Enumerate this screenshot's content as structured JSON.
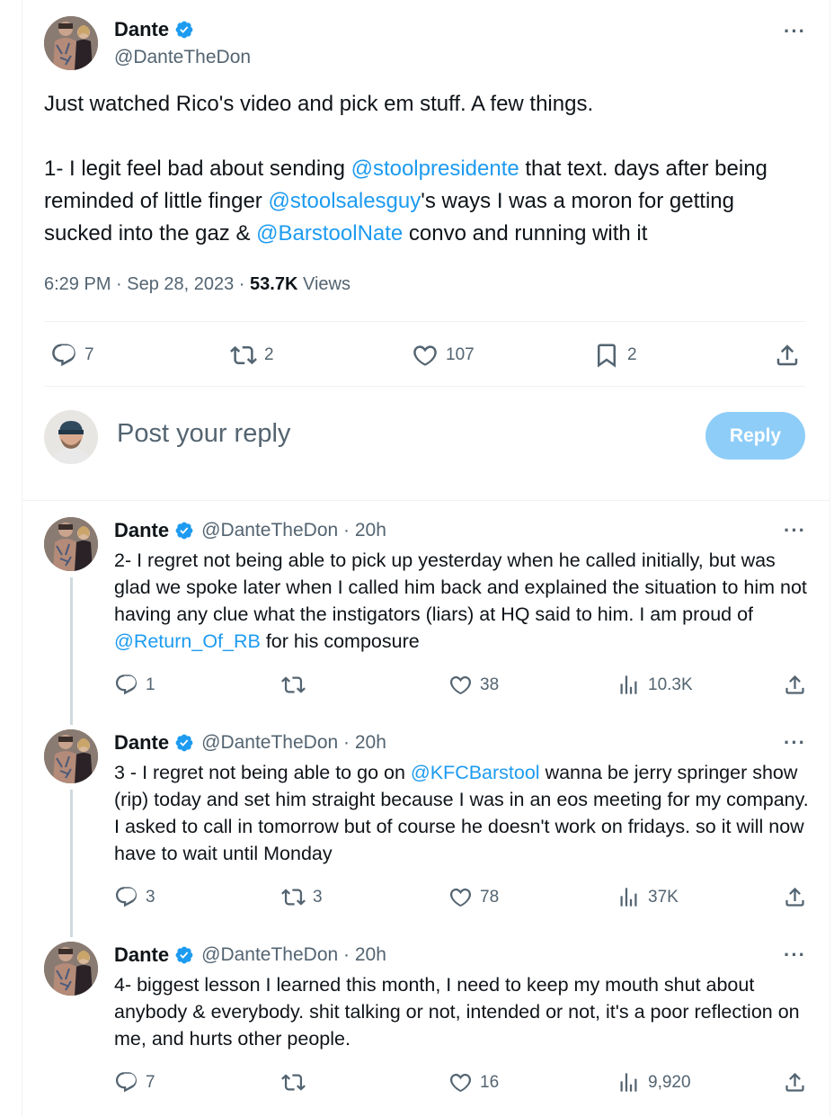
{
  "main_tweet": {
    "author_name": "Dante",
    "handle": "@DanteTheDon",
    "more_label": "···",
    "line1": "Just watched Rico's video and pick em stuff. A few things.",
    "p2_a": "1- I legit feel bad about sending ",
    "p2_m1": "@stoolpresidente",
    "p2_b": " that text. days after being reminded of little finger ",
    "p2_m2": "@stoolsalesguy",
    "p2_c": "'s ways I was a moron for getting sucked into the gaz & ",
    "p2_m3": "@BarstoolNate",
    "p2_d": " convo and running with it",
    "time": "6:29 PM · Sep 28, 2023 · ",
    "views_count": "53.7K",
    "views_label": " Views",
    "replies": "7",
    "reposts": "2",
    "likes": "107",
    "bookmarks": "2"
  },
  "composer": {
    "placeholder": "Post your reply",
    "button_label": "Reply"
  },
  "replies": [
    {
      "author_name": "Dante",
      "meta": "@DanteTheDon · 20h",
      "text_a": "2- I regret not being able to pick up yesterday when he called initially, but was glad we spoke later when I called him back and explained the situation to him not having any clue what the instigators (liars) at HQ said to him. I am proud of ",
      "mention": "@Return_Of_RB",
      "text_b": " for his composure",
      "replies": "1",
      "reposts": "",
      "likes": "38",
      "views": "10.3K"
    },
    {
      "author_name": "Dante",
      "meta": "@DanteTheDon · 20h",
      "text_a": "3 - I regret not being able to go on ",
      "mention": "@KFCBarstool",
      "text_b": " wanna be jerry springer show (rip) today and set him straight because I was in an eos meeting for my company. I asked to call in tomorrow but of course he doesn't work on fridays. so it will now have to wait until Monday",
      "replies": "3",
      "reposts": "3",
      "likes": "78",
      "views": "37K"
    },
    {
      "author_name": "Dante",
      "meta": "@DanteTheDon · 20h",
      "text_a": "4- biggest lesson I learned this month, I need to keep my mouth shut about anybody & everybody. shit talking or not, intended or not, it's a poor reflection on me, and hurts other people.",
      "mention": "",
      "text_b": "",
      "replies": "7",
      "reposts": "",
      "likes": "16",
      "views": "9,920"
    }
  ],
  "colors": {
    "accent": "#1d9bf0",
    "reply_button": "#8ecdf8",
    "secondary_text": "#536471",
    "divider": "#eff3f4"
  },
  "icons": [
    "verified-badge-icon",
    "more-icon",
    "reply-icon",
    "repost-icon",
    "like-icon",
    "bookmark-icon",
    "share-icon",
    "views-icon"
  ]
}
